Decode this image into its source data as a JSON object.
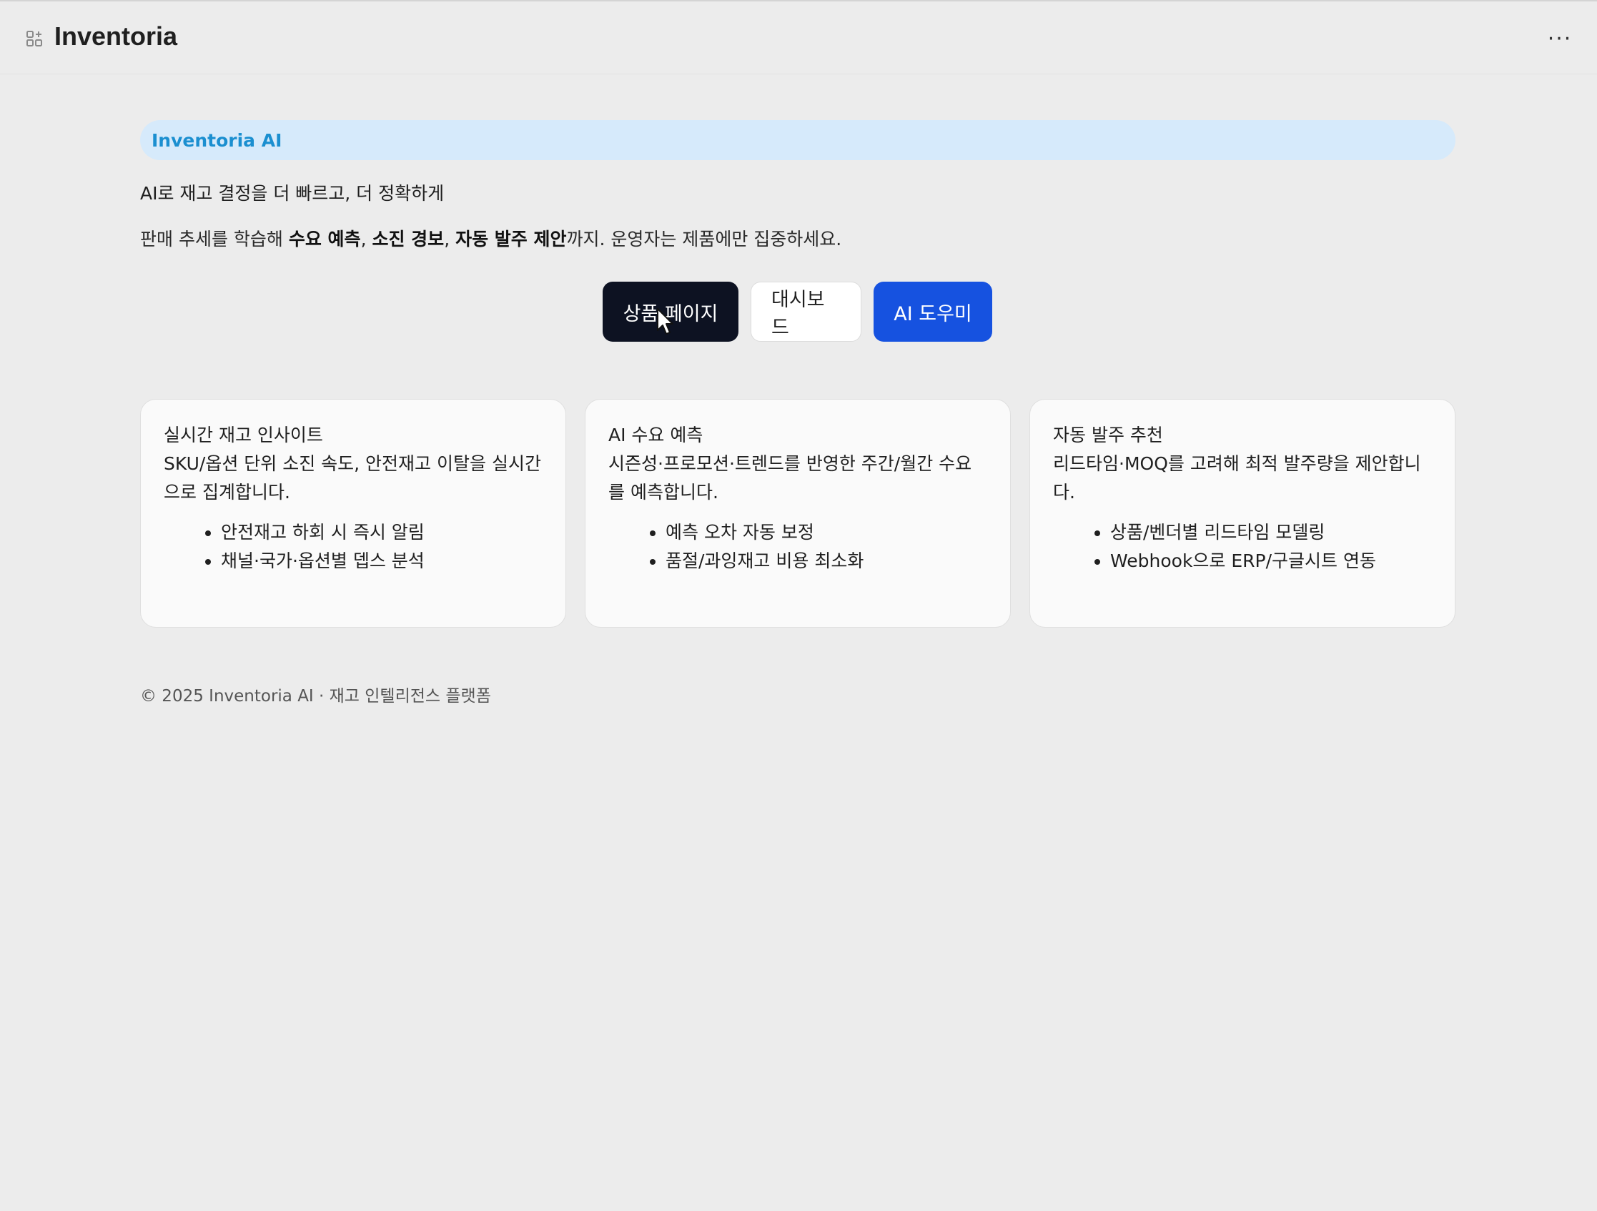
{
  "app": {
    "title": "Inventoria",
    "icon": "app-grid-icon",
    "more_icon": "more-horizontal-icon",
    "more_label": "···"
  },
  "hero": {
    "badge": "Inventoria AI",
    "headline": "AI로 재고 결정을 더 빠르고, 더 정확하게",
    "sub_prefix": "판매 추세를 학습해 ",
    "sub_bold_1": "수요 예측",
    "sub_sep_1": ", ",
    "sub_bold_2": "소진 경보",
    "sub_sep_2": ", ",
    "sub_bold_3": "자동 발주 제안",
    "sub_suffix": "까지. 운영자는 제품에만 집중하세요."
  },
  "buttons": {
    "product_page": "상품 페이지",
    "dashboard": "대시보드",
    "ai_helper": "AI 도우미"
  },
  "cards": [
    {
      "title": "실시간 재고 인사이트",
      "desc": "SKU/옵션 단위 소진 속도, 안전재고 이탈을 실시간으로 집계합니다.",
      "bullets": [
        "안전재고 하회 시 즉시 알림",
        "채널·국가·옵션별 뎁스 분석"
      ]
    },
    {
      "title": "AI 수요 예측",
      "desc": "시즌성·프로모션·트렌드를 반영한 주간/월간 수요를 예측합니다.",
      "bullets": [
        "예측 오차 자동 보정",
        "품절/과잉재고 비용 최소화"
      ]
    },
    {
      "title": "자동 발주 추천",
      "desc": "리드타임·MOQ를 고려해 최적 발주량을 제안합니다.",
      "bullets": [
        "상품/벤더별 리드타임 모델링",
        "Webhook으로 ERP/구글시트 연동"
      ]
    }
  ],
  "footer": {
    "text": "© 2025 Inventoria AI · 재고 인텔리전스 플랫폼"
  },
  "colors": {
    "background": "#ececec",
    "badge_bg": "#d6eafb",
    "badge_text": "#1b8fd0",
    "primary_button": "#0d1222",
    "ai_button": "#1652e0"
  }
}
